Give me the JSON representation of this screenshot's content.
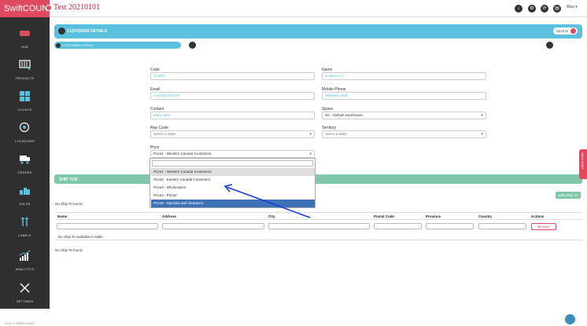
{
  "app": {
    "brand": "SwiftCOUNT",
    "title": "Test 20210101",
    "footer": "2021 © SWIFCOUNT"
  },
  "user_menu": {
    "label": "Mau ▾"
  },
  "sidebar": {
    "items": [
      {
        "label": "HUB",
        "icon": "hub-icon"
      },
      {
        "label": "PRODUCTS",
        "icon": "products-icon"
      },
      {
        "label": "COUNTS",
        "icon": "counts-icon"
      },
      {
        "label": "LOCATIONS",
        "icon": "locations-icon"
      },
      {
        "label": "ORDERS",
        "icon": "orders-icon"
      },
      {
        "label": "SALES",
        "icon": "sales-icon"
      },
      {
        "label": "LABELS",
        "icon": "labels-icon"
      },
      {
        "label": "ANALYTICS",
        "icon": "analytics-icon"
      },
      {
        "label": "SETTINGS",
        "icon": "settings-icon"
      }
    ]
  },
  "panel": {
    "title": "CUSTOMER DETAILS",
    "delete_label": "DELETE",
    "listing_label": "CUSTOMER LISTING"
  },
  "form": {
    "code": {
      "label": "Code",
      "value": "CU200"
    },
    "name": {
      "label": "Name",
      "value": "Customer 3"
    },
    "email": {
      "label": "Email",
      "value": "cust3@mail.com"
    },
    "mobile": {
      "label": "Mobile Phone",
      "value": "(949)554-4556"
    },
    "contact": {
      "label": "Contact",
      "value": "Mary Jane"
    },
    "space": {
      "label": "Space",
      "value": "SC - Default warehouse"
    },
    "rep_code": {
      "label": "Rep Code",
      "placeholder": "Select a State"
    },
    "territory": {
      "label": "Territory",
      "placeholder": "Select a State"
    },
    "price": {
      "label": "Price",
      "value": "Price1 - Western Canada Customers"
    }
  },
  "dropdown": {
    "search_value": "|",
    "options": [
      "Price1 - Western Canada Customers",
      "Price2 - Eastern Canada Customers",
      "Price3 - Wholesalers",
      "Price4 - Priced",
      "Price5 - Specials and clearance"
    ]
  },
  "shiptos": {
    "title": "SHIP TOS",
    "new_button": "New Ship To",
    "not_found_top": "No Ship To found",
    "columns": [
      "Name",
      "Address",
      "City",
      "Postal Code",
      "Province",
      "Country",
      "Actions"
    ],
    "reset_label": "✖ Reset",
    "empty_row": "No Ship To available in table",
    "not_found_bottom": "No Ship To found"
  },
  "side_tab": {
    "label": "Need Help?"
  },
  "colors": {
    "brand": "#e04a5f",
    "accent": "#5bc0de",
    "green": "#7ec8a9",
    "sidebar": "#2f2f2f",
    "selected": "#3d72b4"
  }
}
